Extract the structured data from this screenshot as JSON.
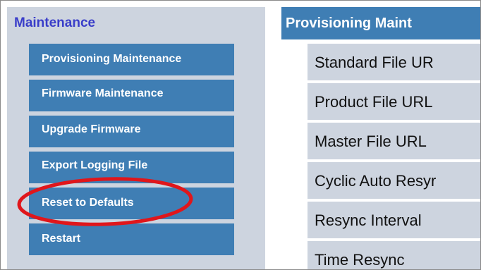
{
  "sidebar": {
    "title": "Maintenance",
    "items": [
      {
        "label": "Provisioning Maintenance"
      },
      {
        "label": "Firmware Maintenance"
      },
      {
        "label": "Upgrade Firmware"
      },
      {
        "label": "Export Logging File"
      },
      {
        "label": "Reset to Defaults"
      },
      {
        "label": "Restart"
      }
    ]
  },
  "main": {
    "title": "Provisioning Maint",
    "rows": [
      {
        "label": "Standard File UR"
      },
      {
        "label": "Product File URL"
      },
      {
        "label": "Master File URL"
      },
      {
        "label": "Cyclic Auto Resyr"
      },
      {
        "label": "Resync Interval"
      },
      {
        "label": "Time Resync"
      }
    ]
  },
  "colors": {
    "accent": "#3f7eb4",
    "panel_bg": "#cdd4df",
    "title_text": "#3a3ec9",
    "annotation": "#e0161b"
  }
}
